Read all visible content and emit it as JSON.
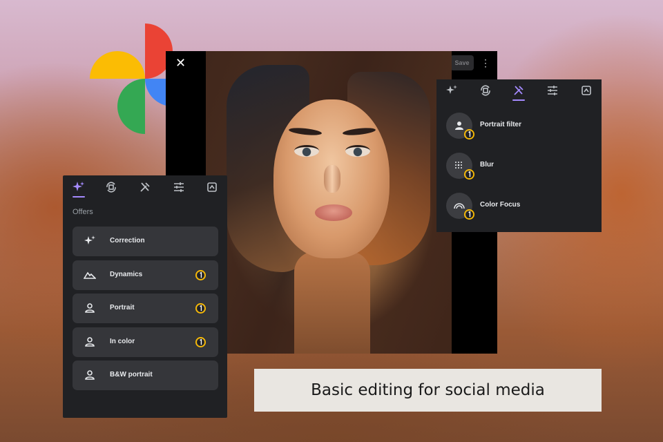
{
  "editor": {
    "close_icon": "close-icon",
    "save_label": "Save",
    "more_icon": "more-vert-icon"
  },
  "left_panel": {
    "tabs": [
      "suggestions-icon",
      "crop-rotate-icon",
      "tools-icon",
      "adjust-icon",
      "markup-icon"
    ],
    "active_tab": 0,
    "section_label": "Offers",
    "items": [
      {
        "label": "Correction",
        "icon": "sparkle-icon",
        "badge": false
      },
      {
        "label": "Dynamics",
        "icon": "mountains-icon",
        "badge": true
      },
      {
        "label": "Portrait",
        "icon": "person-icon",
        "badge": true
      },
      {
        "label": "In color",
        "icon": "person-icon",
        "badge": true
      },
      {
        "label": "B&W portrait",
        "icon": "person-icon",
        "badge": false
      }
    ]
  },
  "right_panel": {
    "tabs": [
      "suggestions-icon",
      "crop-rotate-icon",
      "tools-icon",
      "adjust-icon",
      "markup-icon"
    ],
    "active_tab": 2,
    "items": [
      {
        "label": "Portrait filter",
        "icon": "portrait-filter-icon"
      },
      {
        "label": "Blur",
        "icon": "blur-icon"
      },
      {
        "label": "Color Focus",
        "icon": "color-focus-icon"
      }
    ]
  },
  "caption": {
    "text": "Basic editing for social media"
  },
  "colors": {
    "panel_bg": "#202124",
    "item_bg": "#35363a",
    "accent": "#a58bff",
    "caption_bg": "#e9e6e1"
  }
}
